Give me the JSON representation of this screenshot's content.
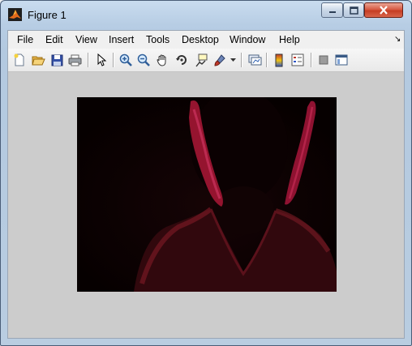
{
  "window": {
    "title": "Figure 1"
  },
  "menu": [
    "File",
    "Edit",
    "View",
    "Insert",
    "Tools",
    "Desktop",
    "Window",
    "Help"
  ],
  "menu_overflow": "↘",
  "toolbar_icons": [
    "new-figure-icon",
    "open-file-icon",
    "save-icon",
    "print-icon",
    "pointer-icon",
    "zoom-in-icon",
    "zoom-out-icon",
    "pan-hand-icon",
    "rotate-3d-icon",
    "data-cursor-icon",
    "brush-icon",
    "dropdown-arrow-icon",
    "link-plot-icon",
    "colorbar-icon",
    "legend-icon",
    "hide-plot-tools-icon",
    "show-plot-tools-icon"
  ],
  "image": {
    "description_color": "#0c0202",
    "accent": "#d8204a"
  }
}
